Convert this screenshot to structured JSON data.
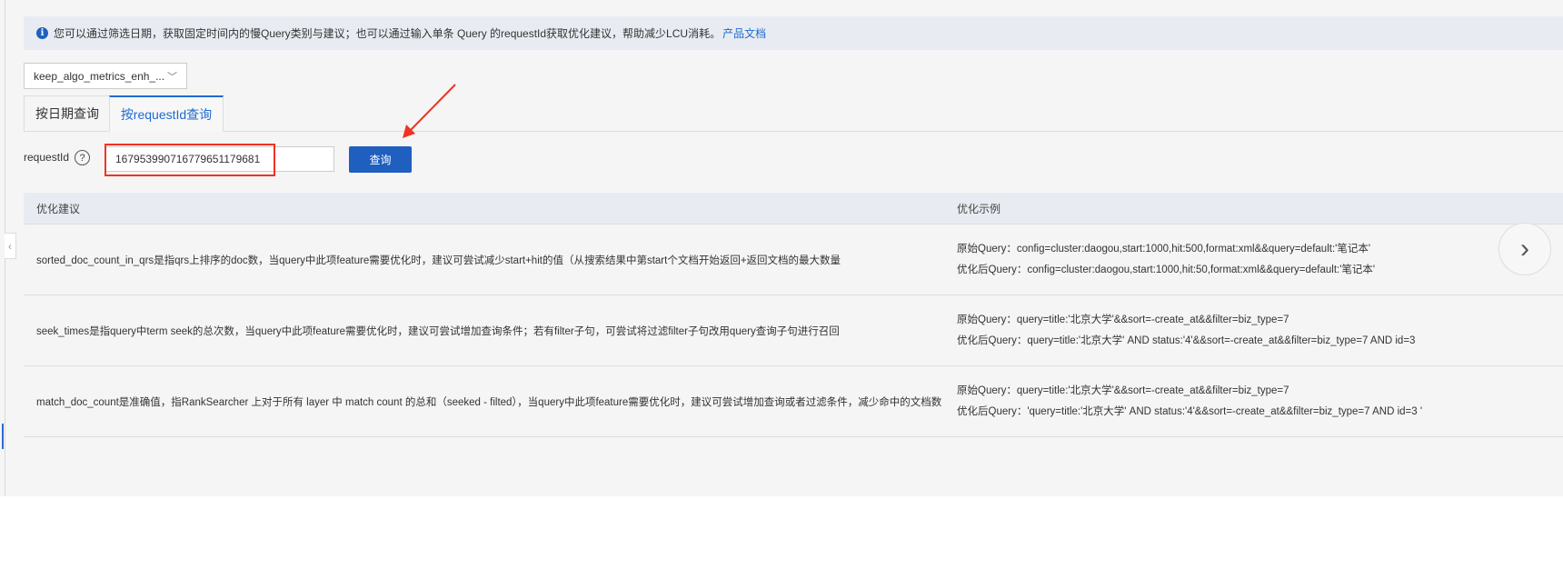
{
  "info": {
    "text": "您可以通过筛选日期，获取固定时间内的慢Query类别与建议；也可以通过输入单条 Query 的requestId获取优化建议，帮助减少LCU消耗。",
    "link": "产品文档"
  },
  "select": {
    "value": "keep_algo_metrics_enh_..."
  },
  "tabs": [
    {
      "label": "按日期查询"
    },
    {
      "label": "按requestId查询"
    }
  ],
  "form": {
    "label": "requestId",
    "value": "1679539907167796511796​81",
    "button": "查询"
  },
  "table": {
    "headers": [
      "优化建议",
      "优化示例"
    ],
    "rows": [
      {
        "suggestion": "sorted_doc_count_in_qrs是指qrs上排序的doc数，当query中此项feature需要优化时，建议可尝试减少start+hit的值（从搜索结果中第start个文档开始返回+返回文档的最大数量",
        "original": "原始Query：config=cluster:daogou,start:1000,hit:500,format:xml&&query=default:'笔记本'",
        "optimized": "优化后Query：config=cluster:daogou,start:1000,hit:50,format:xml&&query=default:'笔记本'"
      },
      {
        "suggestion": "seek_times是指query中term seek的总次数，当query中此项feature需要优化时，建议可尝试增加查询条件；若有filter子句，可尝试将过滤filter子句改用query查询子句进行召回",
        "original": "原始Query：query=title:'北京大学'&&sort=-create_at&&filter=biz_type=7",
        "optimized": "优化后Query：query=title:'北京大学' AND status:'4'&&sort=-create_at&&filter=biz_type=7 AND id=3"
      },
      {
        "suggestion": "match_doc_count是准确值，指RankSearcher 上对于所有 layer 中 match count 的总和（seeked - filted），当query中此项feature需要优化时，建议可尝试增加查询或者过滤条件，减少命中的文档数",
        "original": "原始Query：query=title:'北京大学'&&sort=-create_at&&filter=biz_type=7",
        "optimized": "优化后Query：'query=title:'北京大学' AND status:'4'&&sort=-create_at&&filter=biz_type=7 AND id=3 '"
      }
    ]
  }
}
